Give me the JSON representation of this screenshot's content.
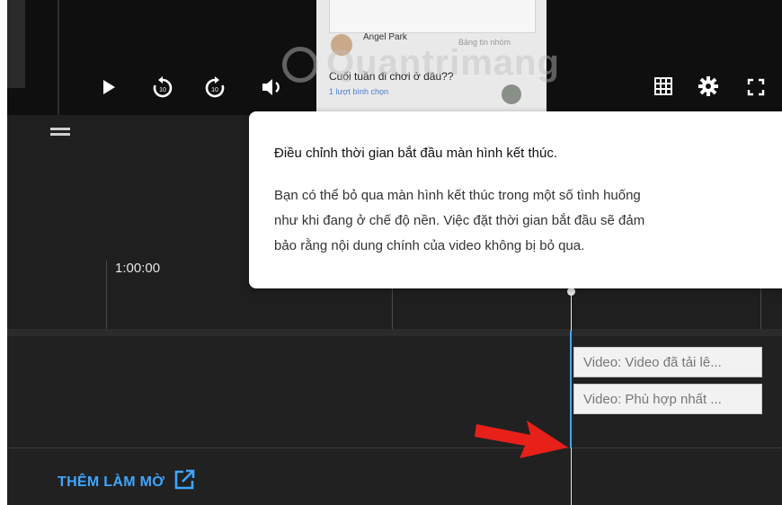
{
  "player": {
    "controls": [
      "play-icon",
      "rewind-10-icon",
      "forward-10-icon",
      "volume-icon",
      "grid-icon",
      "settings-gear-icon",
      "fullscreen-icon"
    ],
    "replay_seconds": "10"
  },
  "preview": {
    "author": "Angel Park",
    "group_label": "Bảng tin nhóm",
    "question": "Cuối tuần đi chơi ở đâu??",
    "votes": "1 lượt bình chọn"
  },
  "watermark": "Quantrimang",
  "timeline": {
    "time_label": "1:00:00"
  },
  "tooltip": {
    "title": "Điều chỉnh thời gian bắt đầu màn hình kết thúc.",
    "body_line1": "Bạn có thể bỏ qua màn hình kết thúc trong một số tình huống",
    "body_line2": "như khi đang ở chế độ nền. Việc đặt thời gian bắt đầu sẽ đảm",
    "body_line3": "bảo rằng nội dung chính của video không bị bỏ qua."
  },
  "elements": [
    {
      "label": "Video: Video đã tải lê..."
    },
    {
      "label": "Video: Phù hợp nhất ..."
    }
  ],
  "add_blur": {
    "label": "THÊM LÀM MỜ",
    "icon": "open-external-icon"
  },
  "colors": {
    "accent": "#3ea6ff",
    "arrow": "#e8201a"
  }
}
